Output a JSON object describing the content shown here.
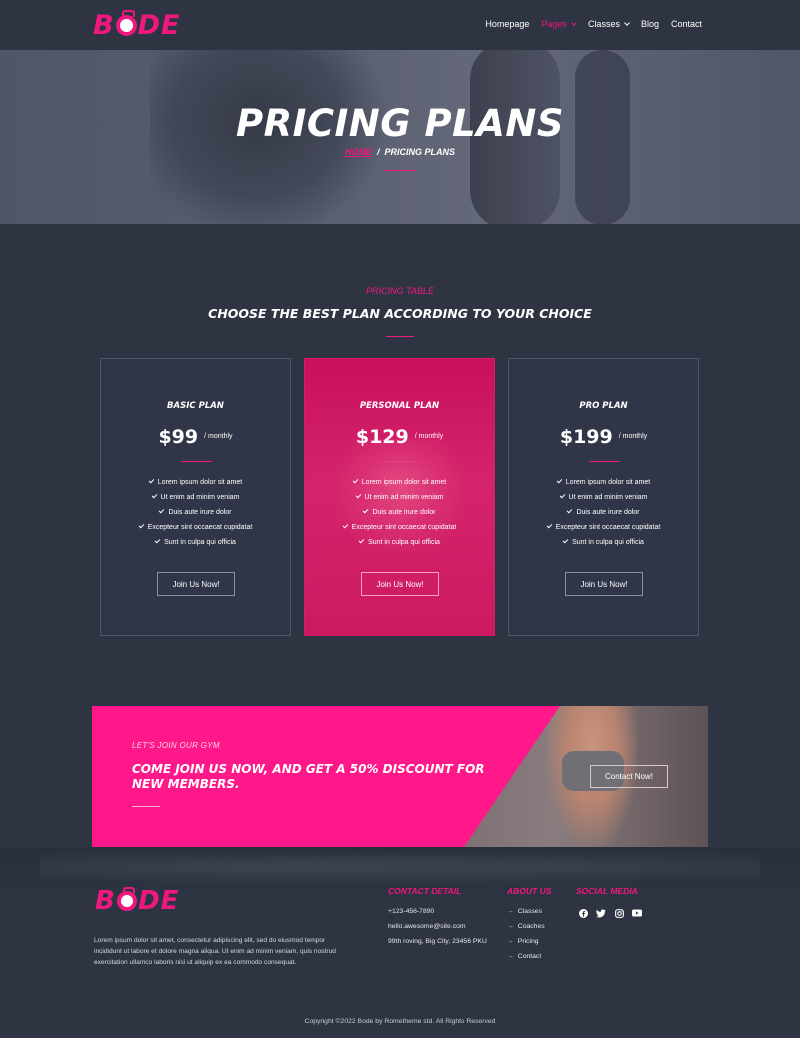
{
  "nav": {
    "logo": "BODE",
    "items": [
      {
        "label": "Homepage",
        "dropdown": false,
        "active": false
      },
      {
        "label": "Pages",
        "dropdown": true,
        "active": true
      },
      {
        "label": "Classes",
        "dropdown": true,
        "active": false
      },
      {
        "label": "Blog",
        "dropdown": false,
        "active": false
      },
      {
        "label": "Contact",
        "dropdown": false,
        "active": false
      }
    ]
  },
  "hero": {
    "title": "PRICING PLANS",
    "breadcrumb_home": "HOME",
    "breadcrumb_sep": "/",
    "breadcrumb_current": "PRICING PLANS"
  },
  "pricing": {
    "subtitle": "PRICING TABLE",
    "title": "CHOOSE THE BEST PLAN ACCORDING TO YOUR CHOICE",
    "plans": [
      {
        "name": "BASIC PLAN",
        "price": "$99",
        "period": "/ monthly",
        "button": "Join Us Now!",
        "features": [
          "Lorem ipsum dolor sit amet",
          "Ut enim ad minim veniam",
          "Duis aute irure dolor",
          "Excepteur sint occaecat cupidatat",
          "Sunt in culpa qui officia"
        ]
      },
      {
        "name": "PERSONAL PLAN",
        "price": "$129",
        "period": "/ monthly",
        "button": "Join Us Now!",
        "features": [
          "Lorem ipsum dolor sit amet",
          "Ut enim ad minim veniam",
          "Duis aute irure dolor",
          "Excepteur sint occaecat cupidatat",
          "Sunt in culpa qui officia"
        ]
      },
      {
        "name": "PRO PLAN",
        "price": "$199",
        "period": "/ monthly",
        "button": "Join Us Now!",
        "features": [
          "Lorem ipsum dolor sit amet",
          "Ut enim ad minim veniam",
          "Duis aute irure dolor",
          "Excepteur sint occaecat cupidatat",
          "Sunt in culpa qui officia"
        ]
      }
    ]
  },
  "cta": {
    "subtitle": "LET'S JOIN OUR GYM",
    "title": "COME JOIN US NOW, AND GET A 50% DISCOUNT FOR NEW MEMBERS.",
    "button": "Contact Now!"
  },
  "footer": {
    "logo": "BODE",
    "about": "Lorem ipsum dolor sit amet, consectetur adipiscing elit, sed do eiusmod tempor incididunt ut labore et dolore magna aliqua. Ut enim ad minim veniam, quis nostrud exercitation ullamco laboris nisi ut aliquip ex ea commodo consequat.",
    "contact_title": "CONTACT DETAIL",
    "contact": [
      "+123-456-7890",
      "hello.awesome@site.com",
      "99th roving, Big City, 23456 PKU"
    ],
    "about_title": "ABOUT US",
    "about_links": [
      "Classes",
      "Coaches",
      "Pricing",
      "Contact"
    ],
    "social_title": "SOCIAL MEDIA",
    "social_icons": [
      "facebook-icon",
      "twitter-icon",
      "instagram-icon",
      "youtube-icon"
    ],
    "copyright": "Copyright ©2022 Bode by Rometheme std. All Rights Reserved"
  },
  "colors": {
    "accent": "#f0177e",
    "background": "#2e3442",
    "cta_pink": "#ff1889"
  }
}
